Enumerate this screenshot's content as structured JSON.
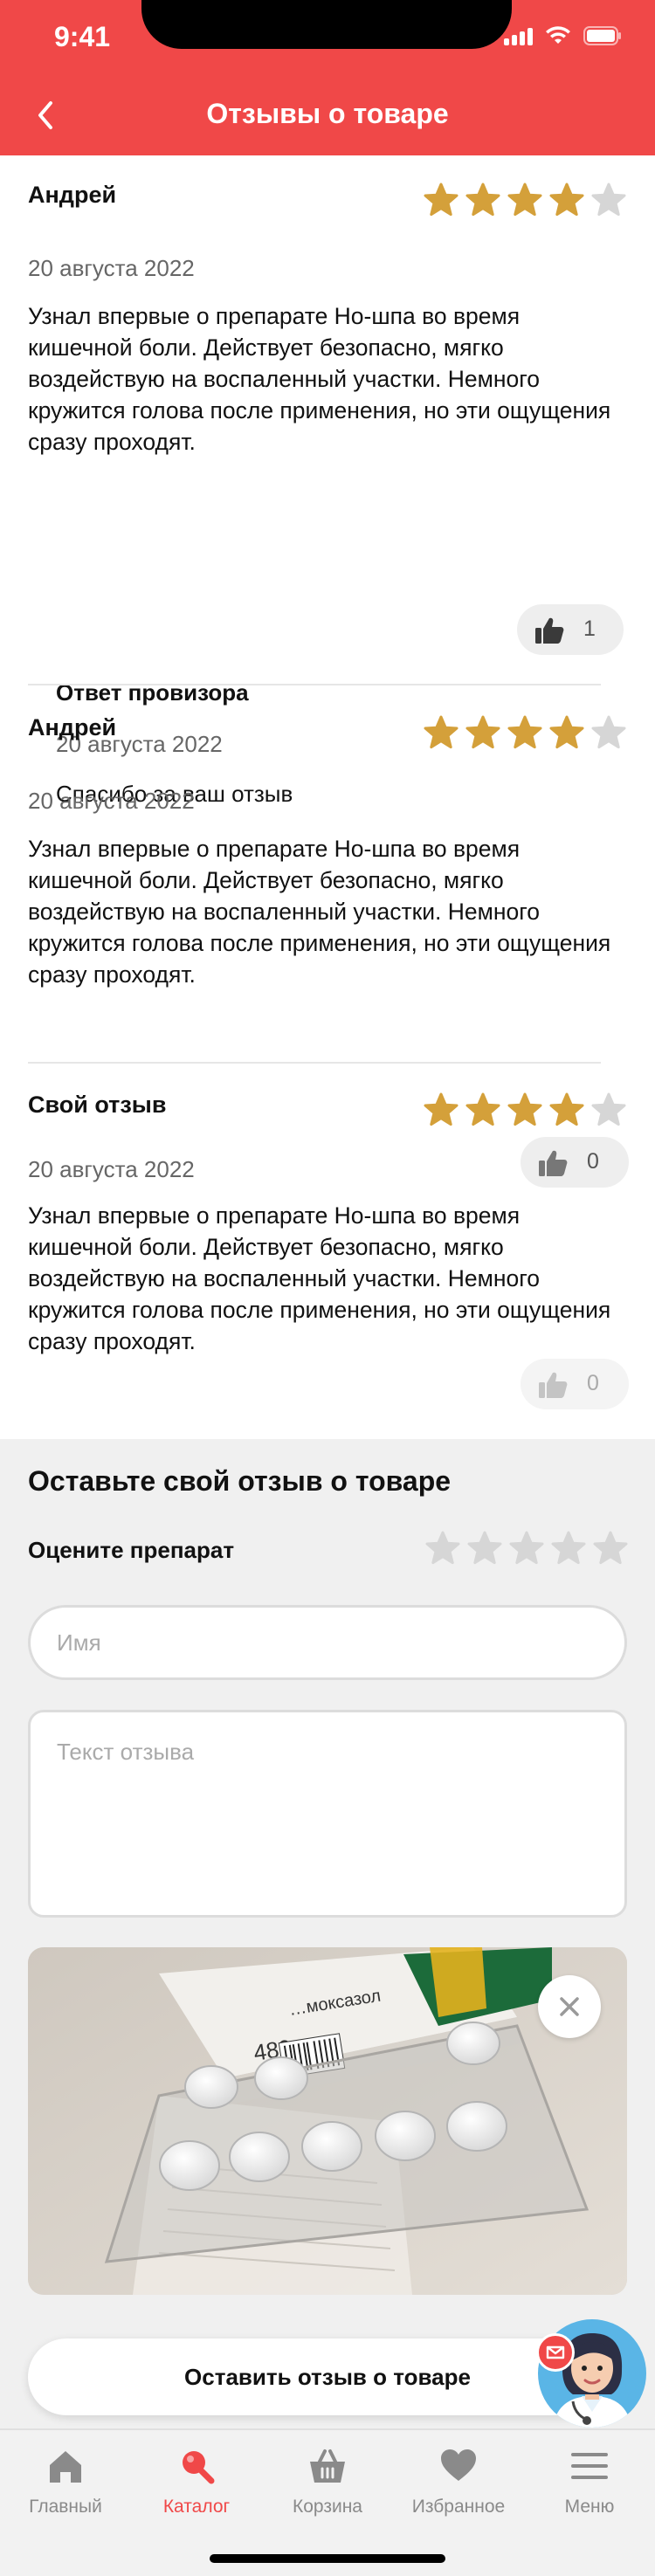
{
  "status_bar": {
    "time": "9:41"
  },
  "header": {
    "title": "Отзывы о товаре",
    "back_icon": "chevron-left-icon"
  },
  "colors": {
    "brand": "#f04848",
    "star_filled": "#d4a03a",
    "star_empty": "#d6d6d6"
  },
  "reviews": [
    {
      "author": "Андрей",
      "rating": 4,
      "max_rating": 5,
      "date": "20 августа 2022",
      "text": "Узнал впервые о препарате Но-шпа во время кишечной боли. Действует безопасно, мягко воздействую на воспаленный участки. Немного кружится голова после применения, но эти ощущения сразу проходят.",
      "likes": "1",
      "reply": {
        "title": "Ответ провизора",
        "date": "20 августа 2022",
        "text": "Спасибо за ваш отзыв"
      }
    },
    {
      "author": "Андрей",
      "rating": 4,
      "max_rating": 5,
      "date": "20 августа 2022",
      "text": "Узнал впервые о препарате Но-шпа во время кишечной боли. Действует безопасно, мягко воздействую на воспаленный участки. Немного кружится голова после применения, но эти ощущения сразу проходят.",
      "likes": "0"
    },
    {
      "author": "Свой отзыв",
      "rating": 4,
      "max_rating": 5,
      "date": "20 августа 2022",
      "text": "Узнал впервые о препарате Но-шпа во время кишечной боли. Действует безопасно, мягко воздействую на воспаленный участки. Немного кружится голова после применения, но эти ощущения сразу проходят.",
      "likes": "0",
      "likes_disabled": true
    }
  ],
  "leave_review": {
    "title": "Оставьте свой отзыв о товаре",
    "rate_label": "Оцените препарат",
    "rating": 0,
    "name_placeholder": "Имя",
    "text_placeholder": "Текст отзыва",
    "photo": {
      "box_label": "…моксазол",
      "box_dose": "480 мг",
      "remove_icon": "close-icon"
    },
    "submit_label": "Оставить отзыв о товаре"
  },
  "assistant": {
    "icon": "pharmacist-avatar-icon",
    "badge_icon": "chat-icon"
  },
  "tabbar": {
    "active": "catalog",
    "items": [
      {
        "id": "home",
        "label": "Главный",
        "icon": "home-icon"
      },
      {
        "id": "catalog",
        "label": "Каталог",
        "icon": "search-icon"
      },
      {
        "id": "cart",
        "label": "Корзина",
        "icon": "basket-icon"
      },
      {
        "id": "favorites",
        "label": "Избранное",
        "icon": "heart-icon"
      },
      {
        "id": "menu",
        "label": "Меню",
        "icon": "menu-icon"
      }
    ]
  }
}
